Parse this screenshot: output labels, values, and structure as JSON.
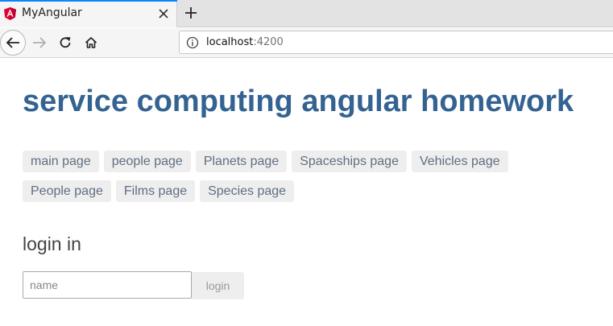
{
  "browser": {
    "tab": {
      "title": "MyAngular",
      "favicon": "angular-icon",
      "close_icon": "close-icon"
    },
    "new_tab_icon": "plus-icon",
    "nav": {
      "back_icon": "back-arrow-icon",
      "forward_icon": "forward-arrow-icon",
      "reload_icon": "reload-icon",
      "home_icon": "home-icon"
    },
    "url": {
      "host": "localhost",
      "port": ":4200",
      "info_icon": "info-icon"
    }
  },
  "page": {
    "title": "service computing angular homework",
    "nav_links": [
      "main page",
      "people page",
      "Planets page",
      "Spaceships page",
      "Vehicles page",
      "People page",
      "Films page",
      "Species page"
    ],
    "login": {
      "heading": "login in",
      "name_placeholder": "name",
      "button_label": "login"
    }
  },
  "colors": {
    "title": "#346392",
    "link_text": "#5f6f81",
    "link_bg": "#eeeeee",
    "tab_accent": "#0a84ff",
    "angular_red": "#dd0031"
  }
}
